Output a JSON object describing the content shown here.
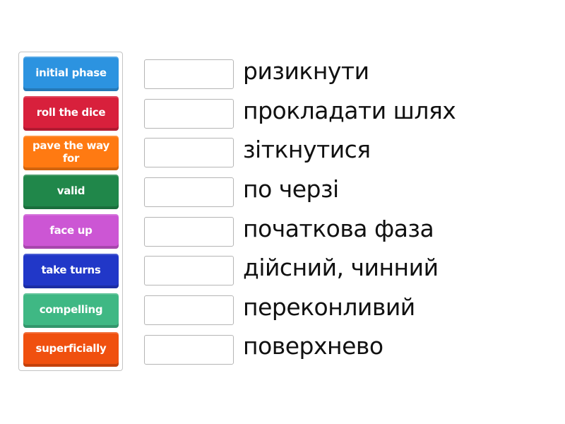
{
  "tiles": [
    {
      "label": "initial phase",
      "color": "#2c93e0"
    },
    {
      "label": "roll the dice",
      "color": "#d8203c"
    },
    {
      "label": "pave the way for",
      "color": "#ff7a12"
    },
    {
      "label": "valid",
      "color": "#20874a"
    },
    {
      "label": "face up",
      "color": "#cc56d4"
    },
    {
      "label": "take turns",
      "color": "#2137c8"
    },
    {
      "label": "compelling",
      "color": "#3fb884"
    },
    {
      "label": "superficially",
      "color": "#f0500f"
    }
  ],
  "definitions": [
    {
      "text": "ризикнути",
      "answer": ""
    },
    {
      "text": "прокладати шлях",
      "answer": ""
    },
    {
      "text": "зіткнутися",
      "answer": ""
    },
    {
      "text": "по черзі",
      "answer": ""
    },
    {
      "text": "початкова фаза",
      "answer": ""
    },
    {
      "text": "дійсний, чинний",
      "answer": ""
    },
    {
      "text": "переконливий",
      "answer": ""
    },
    {
      "text": "поверхнево",
      "answer": ""
    }
  ]
}
